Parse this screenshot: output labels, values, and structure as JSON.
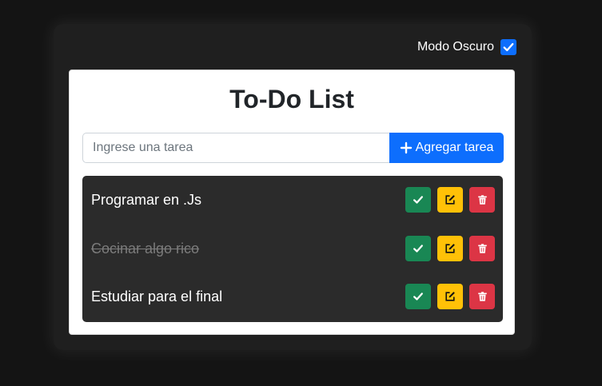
{
  "settings": {
    "dark_mode_label": "Modo Oscuro",
    "dark_mode_checked": true
  },
  "app": {
    "title": "To-Do List"
  },
  "input": {
    "placeholder": "Ingrese una tarea",
    "value": ""
  },
  "add_button": {
    "label": "Agregar tarea"
  },
  "tasks": [
    {
      "text": "Programar en .Js",
      "completed": false
    },
    {
      "text": "Cocinar algo rico",
      "completed": true
    },
    {
      "text": "Estudiar para el final",
      "completed": false
    }
  ],
  "colors": {
    "primary": "#0d6efd",
    "success": "#198754",
    "warning": "#ffc107",
    "danger": "#dc3545",
    "list_background": "#2b2b2b"
  },
  "icons": {
    "checkbox": "check-icon",
    "add": "plus-icon",
    "done": "check-icon",
    "edit": "pencil-square-icon",
    "delete": "trash-icon"
  }
}
